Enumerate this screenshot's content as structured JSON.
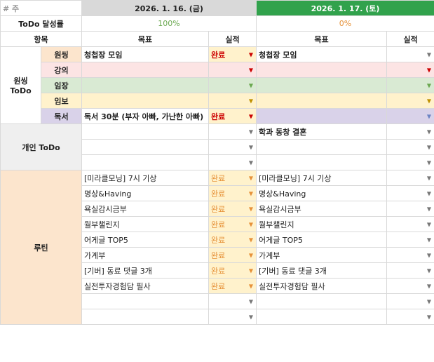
{
  "header": {
    "week_label": "# 주",
    "date1": "2026. 1. 16. (금)",
    "date2": "2026. 1. 17. (토)"
  },
  "todo_rate": {
    "label": "ToDo 달성률",
    "day1": "100%",
    "day2": "0%"
  },
  "columns": {
    "item": "항목",
    "goal": "목표",
    "result": "실적"
  },
  "wonssing": {
    "group_label": "원씽\nToDo",
    "rows": [
      {
        "sub": "원씽",
        "goal1": "청첩장 모임",
        "status1": "완료",
        "goal2": "청첩장 모임",
        "status2": ""
      },
      {
        "sub": "강의",
        "goal1": "",
        "status1": "",
        "goal2": "",
        "status2": ""
      },
      {
        "sub": "임장",
        "goal1": "",
        "status1": "",
        "goal2": "",
        "status2": ""
      },
      {
        "sub": "임보",
        "goal1": "",
        "status1": "",
        "goal2": "",
        "status2": ""
      },
      {
        "sub": "독서",
        "goal1": "독서 30분 (부자 아빠, 가난한 아빠)",
        "status1": "완료",
        "goal2": "",
        "status2": ""
      }
    ]
  },
  "personal": {
    "label": "개인 ToDo",
    "rows": [
      {
        "goal1": "",
        "status1": "",
        "goal2": "학과 동창 결혼",
        "status2": ""
      },
      {
        "goal1": "",
        "status1": "",
        "goal2": "",
        "status2": ""
      },
      {
        "goal1": "",
        "status1": "",
        "goal2": "",
        "status2": ""
      }
    ]
  },
  "routine": {
    "label": "루틴",
    "rows": [
      {
        "goal1": "[미라클모닝] 7시 기상",
        "status1": "완료",
        "goal2": "[미라클모닝] 7시 기상",
        "status2": ""
      },
      {
        "goal1": "명상&Having",
        "status1": "완료",
        "goal2": "명상&Having",
        "status2": ""
      },
      {
        "goal1": "욕실감시금부",
        "status1": "완료",
        "goal2": "욕실감시금부",
        "status2": ""
      },
      {
        "goal1": "월부챌린지",
        "status1": "완료",
        "goal2": "월부챌린지",
        "status2": ""
      },
      {
        "goal1": "어게글 TOP5",
        "status1": "완료",
        "goal2": "어게글 TOP5",
        "status2": ""
      },
      {
        "goal1": "가계부",
        "status1": "완료",
        "goal2": "가계부",
        "status2": ""
      },
      {
        "goal1": "[기버] 동료 댓글 3개",
        "status1": "완료",
        "goal2": "[기버] 동료 댓글 3개",
        "status2": ""
      },
      {
        "goal1": "실전투자경험담 필사",
        "status1": "완료",
        "goal2": "실전투자경험담 필사",
        "status2": ""
      },
      {
        "goal1": "",
        "status1": "",
        "goal2": "",
        "status2": ""
      },
      {
        "goal1": "",
        "status1": "",
        "goal2": "",
        "status2": ""
      }
    ]
  },
  "icons": {
    "dropdown": "dropdown-arrow-icon"
  }
}
